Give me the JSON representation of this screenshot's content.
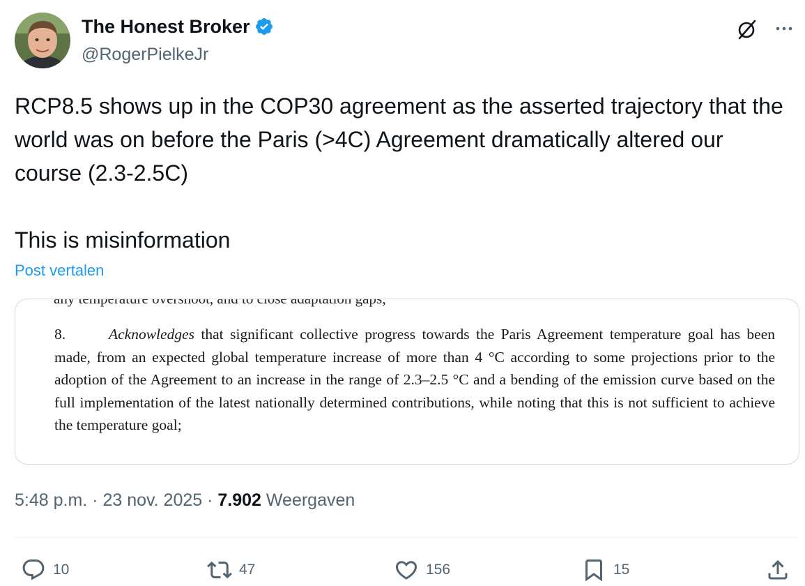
{
  "author": {
    "display_name": "The Honest Broker",
    "handle": "@RogerPielkeJr"
  },
  "tweet": {
    "paragraphs": [
      "RCP8.5 shows up in the COP30 agreement as the asserted trajectory that the world was on before the Paris (>4C) Agreement dramatically altered our course (2.3-2.5C)",
      "This is misinformation"
    ],
    "translate_label": "Post vertalen"
  },
  "media": {
    "cut_line": "any temperature overshoot, and to close adaptation gaps;",
    "paragraph_number": "8.",
    "emphasis_word": "Acknowledges",
    "paragraph_body": " that significant collective progress towards the Paris Agreement temperature goal has been made, from an expected global temperature increase of more than 4 °C according to some projections prior to the adoption of the Agreement to an increase in the range of 2.3–2.5 °C and a bending of the emission curve based on the full implementation of the latest nationally determined contributions, while noting that this is not sufficient to achieve the temperature goal;"
  },
  "meta": {
    "time": "5:48 p.m.",
    "separator": " · ",
    "date": "23 nov. 2025",
    "views_count": "7.902",
    "views_label": " Weergaven"
  },
  "actions": {
    "replies": "10",
    "reposts": "47",
    "likes": "156",
    "bookmarks": "15"
  },
  "colors": {
    "text": "#0f1419",
    "secondary": "#536471",
    "link": "#1d9bf0",
    "verified": "#1d9bf0",
    "border": "#cfd9de"
  },
  "icons": [
    "verified-badge-icon",
    "grok-icon",
    "more-icon",
    "reply-icon",
    "repost-icon",
    "like-icon",
    "bookmark-icon",
    "share-icon"
  ]
}
